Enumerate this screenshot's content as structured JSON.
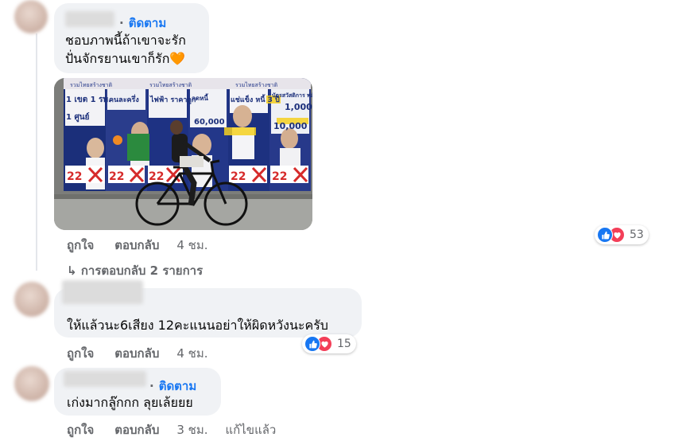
{
  "comments": [
    {
      "follow_label": "ติดตาม",
      "text_line1": "ชอบภาพนี้ถ้าเขาจะรัก",
      "text_line2": "ปั่นจักรยานเขาก็รัก🧡",
      "photo_alt": "ชายปั่นจักรยานผ่านป้ายหาเสียงเลือกตั้ง",
      "photo_texts": {
        "banner": "รวมไทยสร้างชาติ",
        "p1": "1 เขต 1 รพ.",
        "p1b": "1 ศูนย์",
        "p2": "คนละครึ่ง",
        "p3": "ไฟฟ้า ราคาถูก",
        "p4": "ลดหนี้",
        "p4b": "60,000",
        "p5": "แช่แข็ง หนี้ 3 ปี",
        "p6": "บัตรสวัสดิการ พลัส",
        "p6b": "1,000",
        "p6c": "10,000",
        "num": "22"
      },
      "like_label": "ถูกใจ",
      "reply_label": "ตอบกลับ",
      "time": "4 ชม.",
      "reaction_count": "53",
      "replies_link": "การตอบกลับ 2 รายการ"
    },
    {
      "text": "ให้แล้วนะ6เสียง 12คะแนนอย่าให้ผิดหวังนะครับ",
      "like_label": "ถูกใจ",
      "reply_label": "ตอบกลับ",
      "time": "4 ชม.",
      "reaction_count": "15"
    },
    {
      "follow_label": "ติดตาม",
      "text": "เก่งมากลู๊กกก ลุยเล้ยยย",
      "like_label": "ถูกใจ",
      "reply_label": "ตอบกลับ",
      "time": "3 ชม.",
      "edited_label": "แก้ไขแล้ว"
    }
  ],
  "colors": {
    "bubble": "#f0f2f5",
    "link_blue": "#1877f2",
    "meta_gray": "#65676b",
    "like_blue": "#1877f2",
    "love_red": "#f33e58"
  }
}
